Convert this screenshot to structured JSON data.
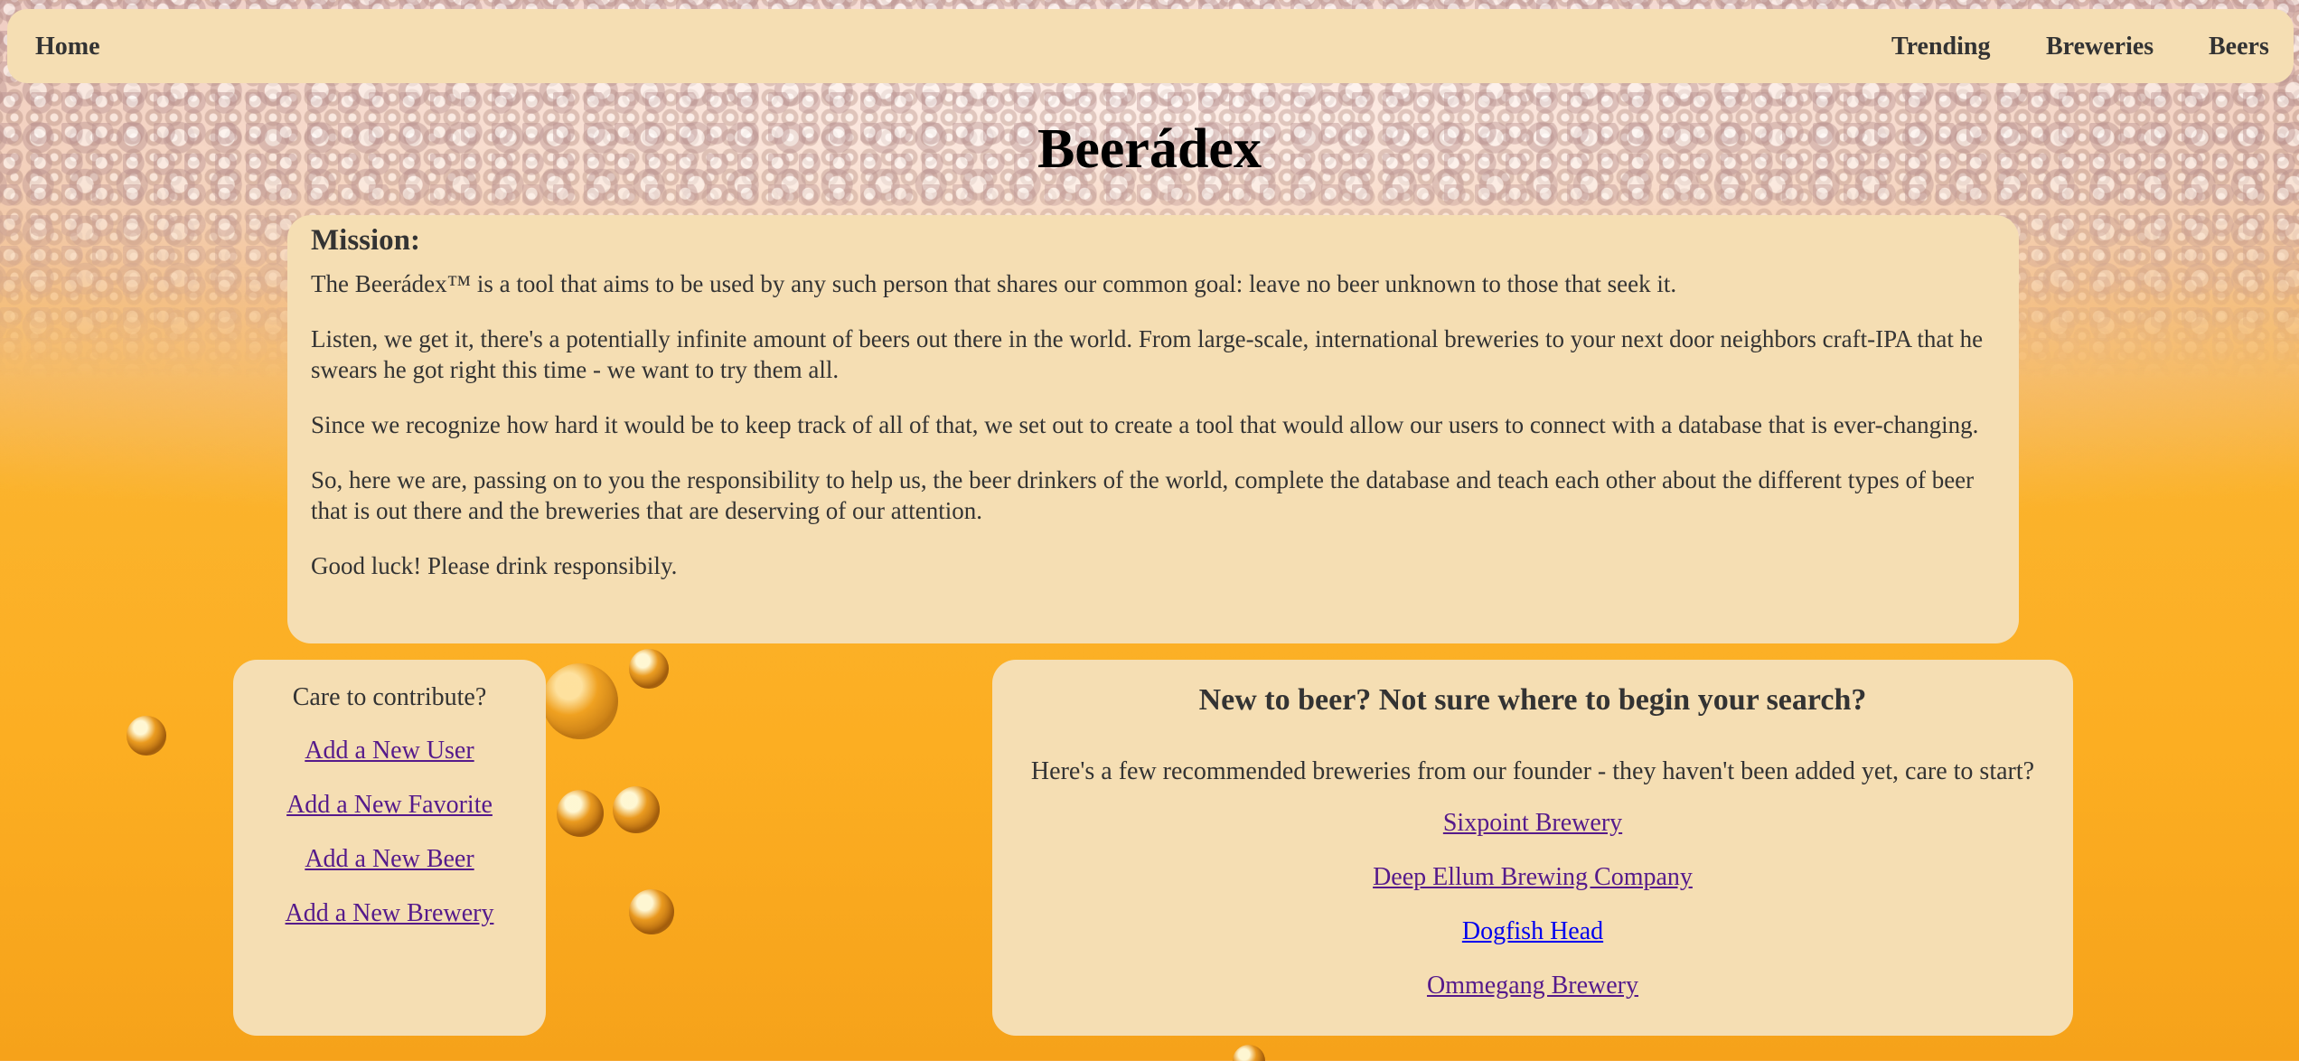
{
  "nav": {
    "home": "Home",
    "trending": "Trending",
    "breweries": "Breweries",
    "beers": "Beers"
  },
  "title": "Beerádex",
  "mission": {
    "heading": "Mission:",
    "paragraphs": [
      "The Beerádex™  is a tool that aims to be used by any such person that shares our common goal: leave no beer unknown to those that seek it.",
      "Listen, we get it, there's a potentially infinite amount of beers out there in the world. From large-scale, international breweries to your next door neighbors craft-IPA that he swears he got right this time - we want to try them all.",
      "Since we recognize how hard it would be to keep track of all of that, we set out to create a tool that would allow our users to connect with a database that is ever-changing.",
      "So, here we are, passing on to you the responsibility to help us, the beer drinkers of the world, complete the database and teach each other about the different types of beer that is out there and the breweries that are deserving of our attention.",
      "Good luck! Please drink responsibily."
    ]
  },
  "contribute": {
    "heading": "Care to contribute?",
    "links": [
      "Add a New User",
      "Add a New Favorite",
      "Add a New Beer",
      "Add a New Brewery"
    ]
  },
  "recommend": {
    "heading": "New to beer? Not sure where to begin your search?",
    "intro": "Here's a few recommended breweries from our founder - they haven't been added yet, care to start?",
    "links": [
      "Sixpoint Brewery",
      "Deep Ellum Brewing Company",
      "Dogfish Head",
      "Ommegang Brewery"
    ]
  },
  "colors": {
    "panel": "#f5deb3",
    "visited_link": "#551a8b",
    "link": "#0000ee"
  }
}
